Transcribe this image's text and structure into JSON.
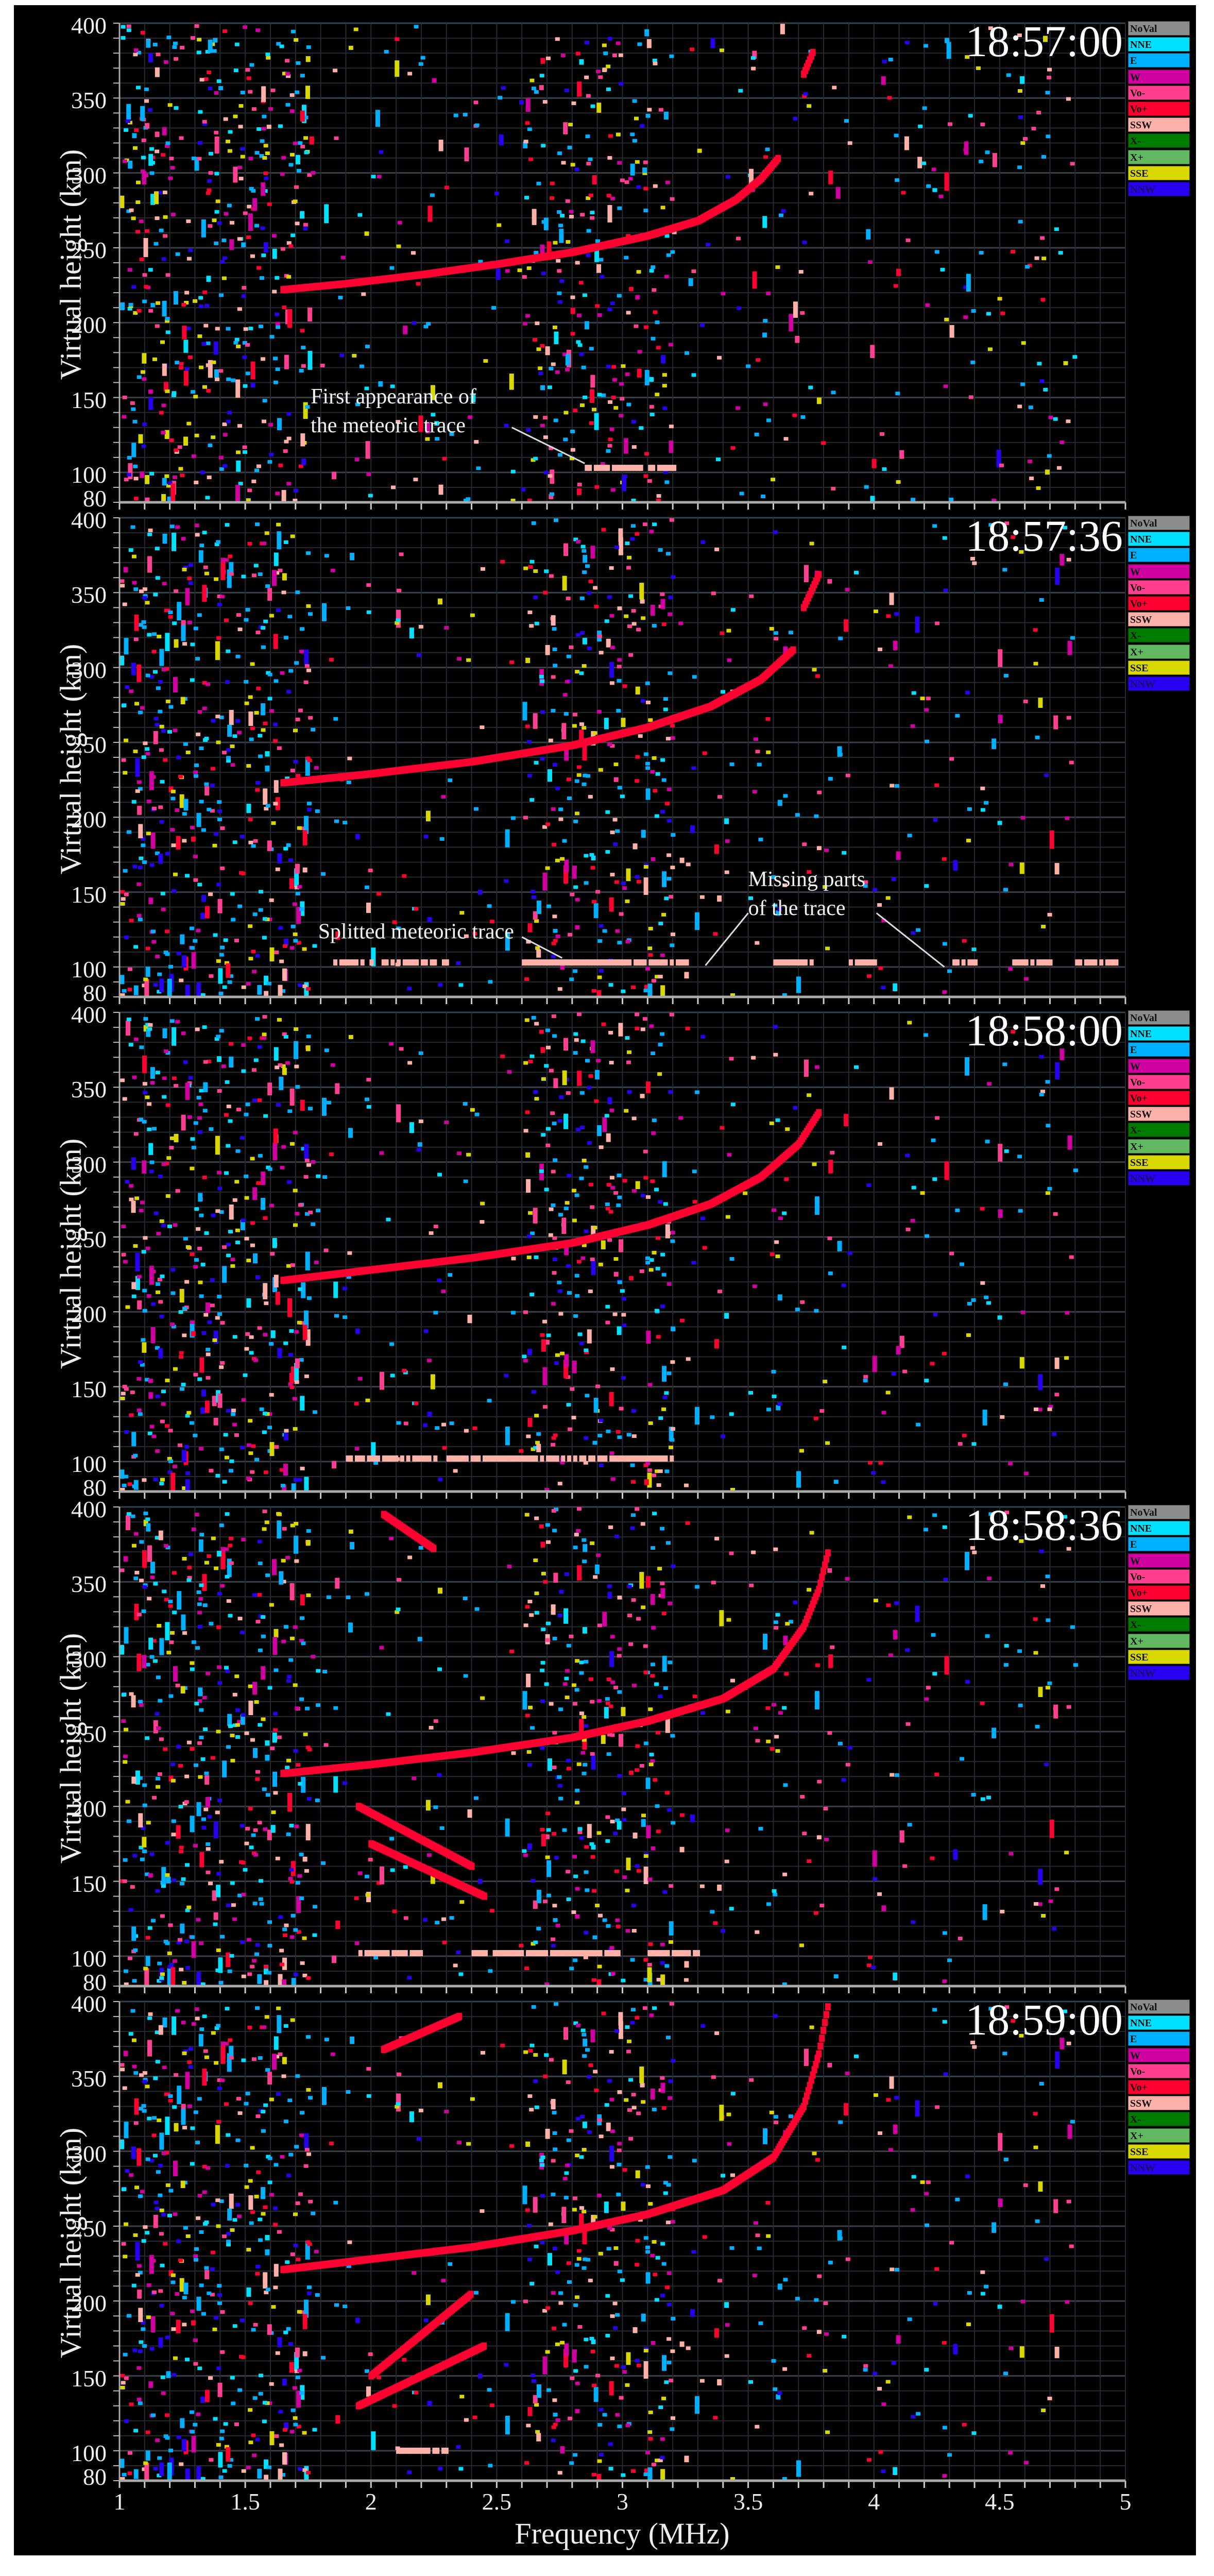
{
  "chart_data": {
    "type": "scatter",
    "title": "Ionogram sequence with meteoric trace",
    "xlabel": "Frequency (MHz)",
    "ylabel": "Virtual height (km)",
    "xlim": [
      1,
      5
    ],
    "ylim": [
      80,
      400
    ],
    "x_ticks": [
      "1",
      "1.5",
      "2",
      "2.5",
      "3",
      "3.5",
      "4",
      "4.5",
      "5"
    ],
    "y_ticks": [
      "400",
      "350",
      "300",
      "250",
      "200",
      "150",
      "100",
      "80"
    ],
    "grid": true,
    "legend_placement": "right",
    "legend": [
      {
        "label": "NoVal",
        "color": "#8c8c8c"
      },
      {
        "label": "NNE",
        "color": "#00e0ff"
      },
      {
        "label": "E",
        "color": "#00b0ff"
      },
      {
        "label": "W",
        "color": "#d000a0"
      },
      {
        "label": "Vo-",
        "color": "#ff4090"
      },
      {
        "label": "Vo+",
        "color": "#ff0030"
      },
      {
        "label": "SSW",
        "color": "#ffb0a8"
      },
      {
        "label": "X-",
        "color": "#007a00"
      },
      {
        "label": "X+",
        "color": "#60b860"
      },
      {
        "label": "SSE",
        "color": "#d8d800"
      },
      {
        "label": "NNW",
        "color": "#2800f0"
      }
    ],
    "panels": [
      {
        "time": "18:57:00",
        "o_trace": [
          [
            1.65,
            222
          ],
          [
            1.9,
            226
          ],
          [
            2.2,
            232
          ],
          [
            2.5,
            239
          ],
          [
            2.8,
            247
          ],
          [
            3.1,
            258
          ],
          [
            3.3,
            268
          ],
          [
            3.45,
            282
          ],
          [
            3.55,
            296
          ],
          [
            3.62,
            310
          ]
        ],
        "extra_traces": [
          [
            [
              3.72,
              366
            ],
            [
              3.76,
              382
            ]
          ]
        ],
        "meteor_segments": [
          [
            2.85,
            3.2,
            103
          ]
        ],
        "annotations": [
          {
            "lines": [
              "First   appearance   of",
              "the meteoric trace"
            ],
            "text_at": [
              1.76,
              146
            ],
            "arrows": [
              [
                [
                  2.56,
                  130
                ],
                [
                  2.85,
                  106
                ]
              ]
            ]
          }
        ]
      },
      {
        "time": "18:57:36",
        "o_trace": [
          [
            1.65,
            223
          ],
          [
            2.0,
            229
          ],
          [
            2.4,
            237
          ],
          [
            2.8,
            248
          ],
          [
            3.1,
            260
          ],
          [
            3.35,
            274
          ],
          [
            3.55,
            292
          ],
          [
            3.68,
            312
          ]
        ],
        "extra_traces": [
          [
            [
              3.72,
              340
            ],
            [
              3.78,
              362
            ]
          ]
        ],
        "meteor_segments": [
          [
            1.85,
            2.3,
            103
          ],
          [
            2.6,
            3.25,
            103
          ],
          [
            3.6,
            3.75,
            103
          ],
          [
            3.9,
            4.0,
            103
          ],
          [
            4.3,
            4.4,
            103
          ],
          [
            4.55,
            4.7,
            103
          ],
          [
            4.8,
            4.97,
            103
          ]
        ],
        "annotations": [
          {
            "lines": [
              "Splitted meteoric trace"
            ],
            "text_at": [
              1.79,
              119
            ],
            "arrows": [
              [
                [
                  2.6,
                  120
                ],
                [
                  2.76,
                  106
                ]
              ]
            ]
          },
          {
            "lines": [
              "Missing  parts",
              "of the trace"
            ],
            "text_at": [
              3.5,
              154
            ],
            "arrows": [
              [
                [
                  3.5,
                  136
                ],
                [
                  3.33,
                  101
                ]
              ],
              [
                [
                  4.01,
                  136
                ],
                [
                  4.28,
                  100
                ]
              ]
            ]
          }
        ]
      },
      {
        "time": "18:58:00",
        "o_trace": [
          [
            1.65,
            221
          ],
          [
            2.0,
            228
          ],
          [
            2.4,
            236
          ],
          [
            2.8,
            246
          ],
          [
            3.1,
            258
          ],
          [
            3.35,
            272
          ],
          [
            3.55,
            290
          ],
          [
            3.7,
            312
          ],
          [
            3.78,
            333
          ]
        ],
        "extra_traces": [],
        "meteor_segments": [
          [
            1.9,
            2.25,
            102
          ],
          [
            2.3,
            3.2,
            102
          ]
        ],
        "annotations": []
      },
      {
        "time": "18:58:36",
        "o_trace": [
          [
            1.65,
            222
          ],
          [
            2.0,
            228
          ],
          [
            2.4,
            236
          ],
          [
            2.8,
            246
          ],
          [
            3.1,
            257
          ],
          [
            3.4,
            272
          ],
          [
            3.6,
            292
          ],
          [
            3.72,
            320
          ],
          [
            3.78,
            345
          ],
          [
            3.82,
            372
          ]
        ],
        "extra_traces": [
          [
            [
              2.05,
              395
            ],
            [
              2.25,
              372
            ]
          ],
          [
            [
              1.95,
              200
            ],
            [
              2.4,
              160
            ]
          ],
          [
            [
              2.0,
              175
            ],
            [
              2.45,
              140
            ]
          ]
        ],
        "meteor_segments": [
          [
            1.95,
            2.2,
            102
          ],
          [
            2.4,
            3.0,
            102
          ],
          [
            3.1,
            3.3,
            102
          ]
        ],
        "annotations": []
      },
      {
        "time": "18:59:00",
        "o_trace": [
          [
            1.65,
            221
          ],
          [
            2.0,
            228
          ],
          [
            2.4,
            236
          ],
          [
            2.8,
            247
          ],
          [
            3.1,
            258
          ],
          [
            3.4,
            274
          ],
          [
            3.6,
            296
          ],
          [
            3.72,
            330
          ],
          [
            3.78,
            365
          ],
          [
            3.82,
            400
          ]
        ],
        "extra_traces": [
          [
            [
              2.05,
              368
            ],
            [
              2.35,
              390
            ]
          ],
          [
            [
              1.95,
              130
            ],
            [
              2.45,
              170
            ]
          ],
          [
            [
              2.0,
              150
            ],
            [
              2.4,
              205
            ]
          ]
        ],
        "meteor_segments": [
          [
            2.1,
            2.3,
            100
          ]
        ],
        "annotations": []
      }
    ]
  }
}
